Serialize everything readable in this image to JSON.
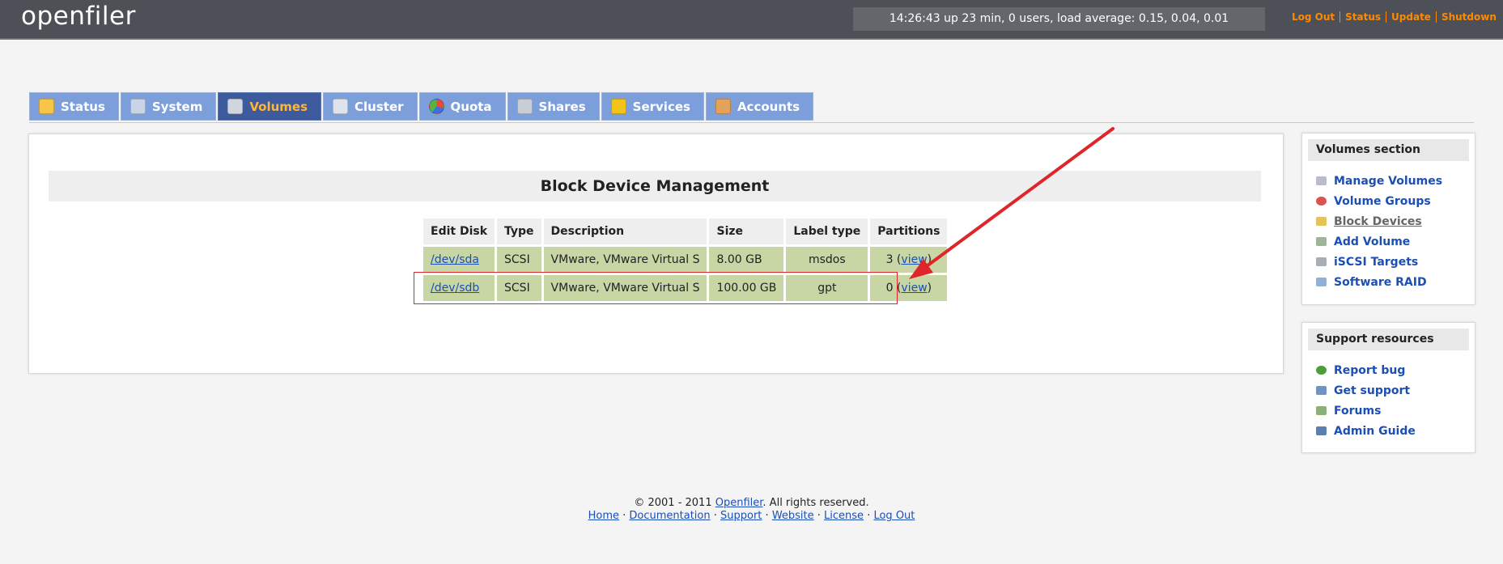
{
  "header": {
    "logo": "openfiler",
    "uptime": "14:26:43 up 23 min, 0 users, load average: 0.15, 0.04, 0.01",
    "links": [
      "Log Out",
      "Status",
      "Update",
      "Shutdown"
    ]
  },
  "tabs": [
    {
      "label": "Status",
      "icon": "sun-cloud-icon",
      "color": "#f6c54a"
    },
    {
      "label": "System",
      "icon": "computer-icon",
      "color": "#c9d4e6"
    },
    {
      "label": "Volumes",
      "icon": "disk-icon",
      "color": "#cfd6df",
      "active": true
    },
    {
      "label": "Cluster",
      "icon": "cluster-icon",
      "color": "#e0e4ea"
    },
    {
      "label": "Quota",
      "icon": "pie-chart-icon",
      "color": "#56b346"
    },
    {
      "label": "Shares",
      "icon": "server-icon",
      "color": "#c9ced6"
    },
    {
      "label": "Services",
      "icon": "lightning-icon",
      "color": "#f2c318"
    },
    {
      "label": "Accounts",
      "icon": "users-icon",
      "color": "#e4a25a"
    }
  ],
  "main": {
    "title": "Block Device Management",
    "columns": [
      "Edit Disk",
      "Type",
      "Description",
      "Size",
      "Label type",
      "Partitions"
    ],
    "rows": [
      {
        "disk": "/dev/sda",
        "type": "SCSI",
        "description": "VMware, VMware Virtual S",
        "size": "8.00 GB",
        "label_type": "msdos",
        "partitions_count": "3",
        "view": "view"
      },
      {
        "disk": "/dev/sdb",
        "type": "SCSI",
        "description": "VMware, VMware Virtual S",
        "size": "100.00 GB",
        "label_type": "gpt",
        "partitions_count": "0",
        "view": "view"
      }
    ]
  },
  "sidebar": {
    "volumes": {
      "title": "Volumes section",
      "items": [
        {
          "label": "Manage Volumes",
          "icon": "disk-icon"
        },
        {
          "label": "Volume Groups",
          "icon": "volume-groups-icon"
        },
        {
          "label": "Block Devices",
          "icon": "block-device-icon",
          "current": true
        },
        {
          "label": "Add Volume",
          "icon": "add-disk-icon"
        },
        {
          "label": "iSCSI Targets",
          "icon": "iscsi-icon"
        },
        {
          "label": "Software RAID",
          "icon": "raid-icon"
        }
      ]
    },
    "support": {
      "title": "Support resources",
      "items": [
        {
          "label": "Report bug",
          "icon": "bug-icon"
        },
        {
          "label": "Get support",
          "icon": "support-icon"
        },
        {
          "label": "Forums",
          "icon": "forums-icon"
        },
        {
          "label": "Admin Guide",
          "icon": "book-icon"
        }
      ]
    }
  },
  "footer": {
    "copyright_prefix": "© 2001 - 2011",
    "copyright_link": "Openfiler",
    "copyright_suffix": ". All rights reserved.",
    "links": [
      "Home",
      "Documentation",
      "Support",
      "Website",
      "License",
      "Log Out"
    ]
  },
  "annotation": {
    "highlight_color": "#e0252a"
  }
}
